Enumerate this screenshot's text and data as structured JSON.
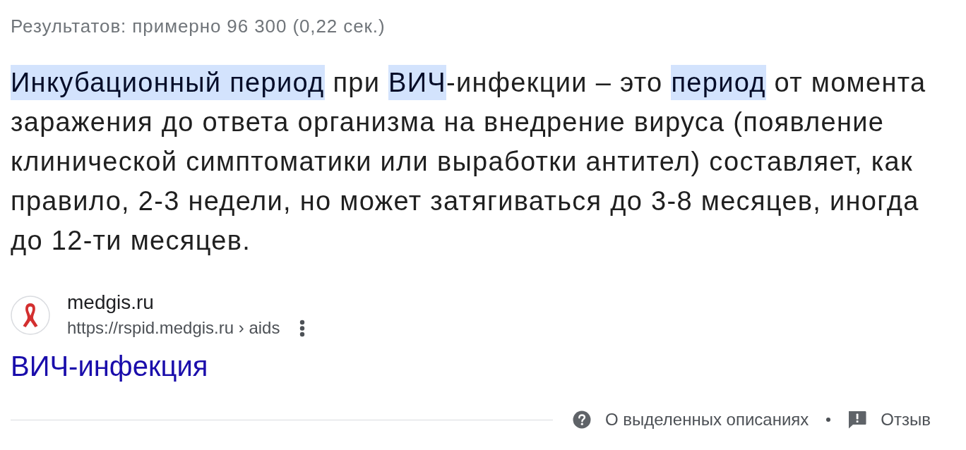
{
  "results_stats": "Результатов: примерно 96 300 (0,22 сек.)",
  "snippet": {
    "segments": [
      {
        "text": "Инкубационный период",
        "highlighted": true
      },
      {
        "text": " при ",
        "highlighted": false
      },
      {
        "text": "ВИЧ",
        "highlighted": true
      },
      {
        "text": "-инфекции – это ",
        "highlighted": false
      },
      {
        "text": "период",
        "highlighted": true
      },
      {
        "text": " от момента заражения до ответа организма на внедрение вируса (появление клинической симптоматики или выработки антител) составляет, как правило, 2-3 недели, но может затягиваться до 3-8 месяцев, иногда до 12-ти месяцев.",
        "highlighted": false
      }
    ]
  },
  "source": {
    "site_name": "medgis.ru",
    "url": "https://rspid.medgis.ru › aids",
    "title": "ВИЧ-инфекция"
  },
  "footer": {
    "links": [
      {
        "kind": "help",
        "label": "О выделенных описаниях"
      },
      {
        "kind": "feedback",
        "label": "Отзыв"
      }
    ]
  }
}
